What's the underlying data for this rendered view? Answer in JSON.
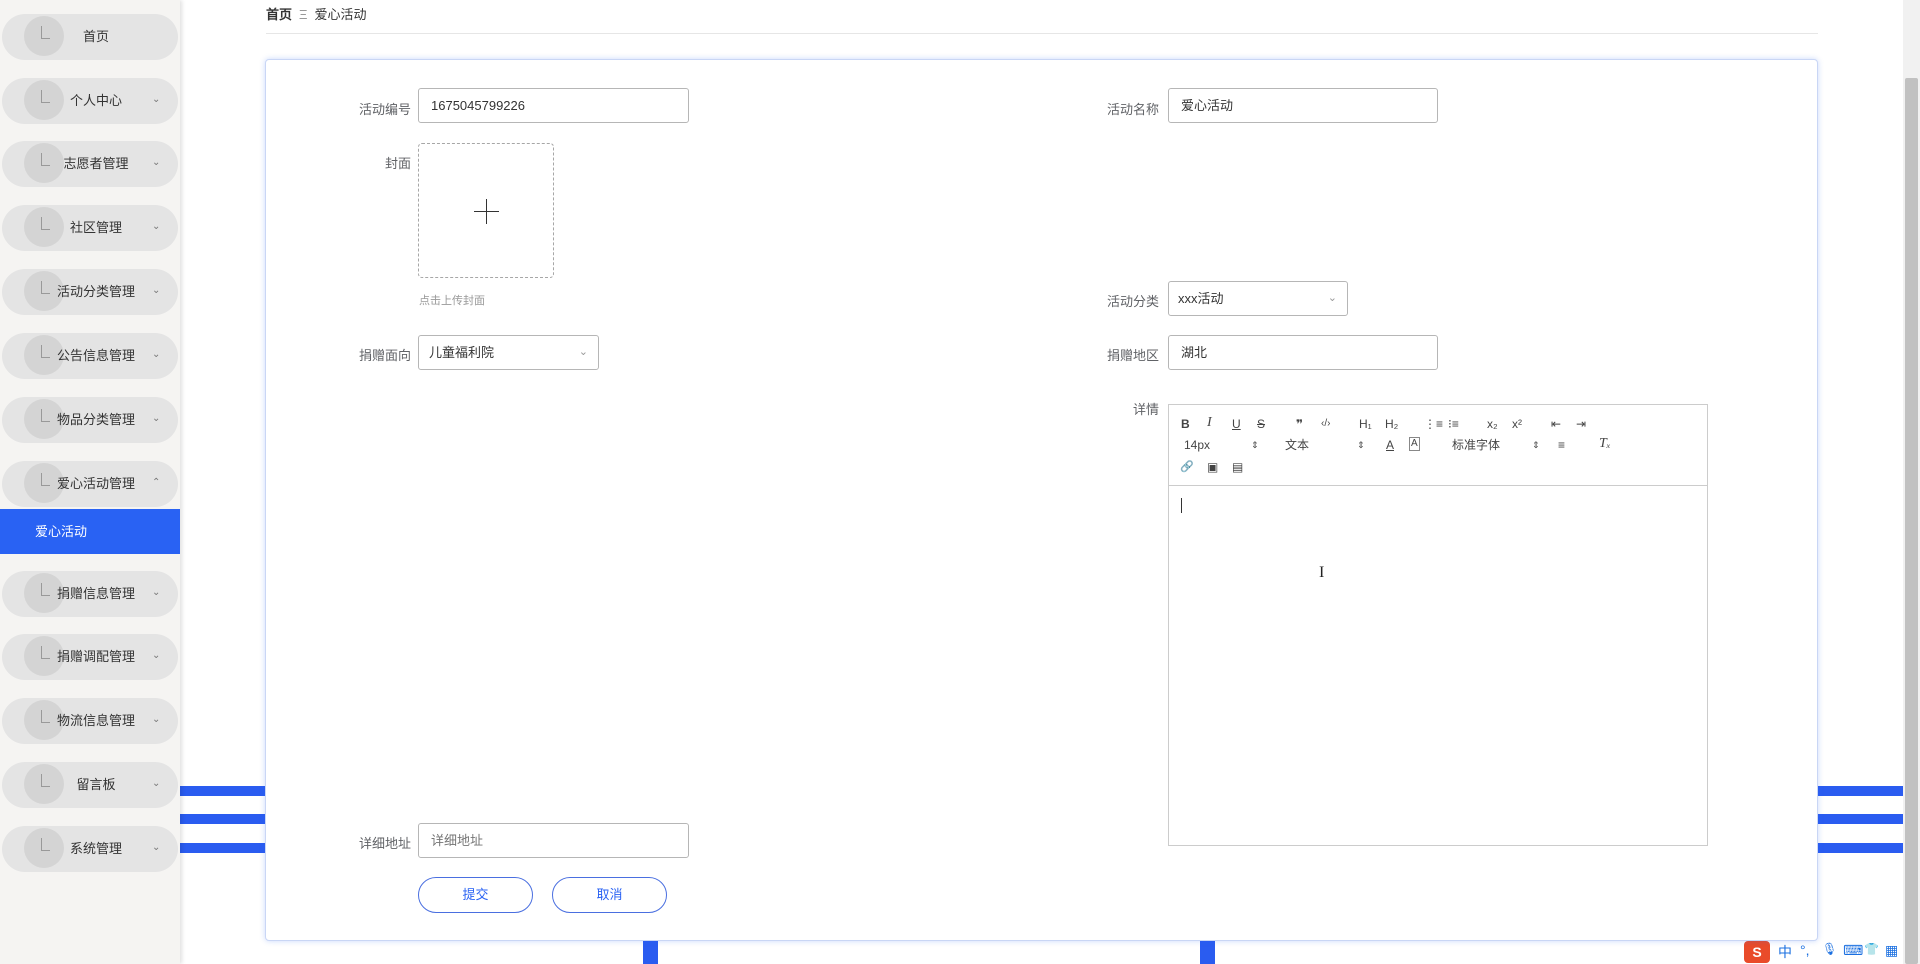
{
  "sidebar": {
    "items": [
      {
        "label": "首页",
        "arrow": ""
      },
      {
        "label": "个人中心",
        "arrow": "⌄"
      },
      {
        "label": "志愿者管理",
        "arrow": "⌄"
      },
      {
        "label": "社区管理",
        "arrow": "⌄"
      },
      {
        "label": "活动分类管理",
        "arrow": "⌄"
      },
      {
        "label": "公告信息管理",
        "arrow": "⌄"
      },
      {
        "label": "物品分类管理",
        "arrow": "⌄"
      },
      {
        "label": "爱心活动管理",
        "arrow": "⌃"
      },
      {
        "label": "捐赠信息管理",
        "arrow": "⌄"
      },
      {
        "label": "捐赠调配管理",
        "arrow": "⌄"
      },
      {
        "label": "物流信息管理",
        "arrow": "⌄"
      },
      {
        "label": "留言板",
        "arrow": "⌄"
      },
      {
        "label": "系统管理",
        "arrow": "⌄"
      }
    ],
    "active_sub": "爱心活动"
  },
  "breadcrumb": {
    "home": "首页",
    "separator": "Ξ",
    "current": "爱心活动"
  },
  "form": {
    "activity_no_label": "活动编号",
    "activity_no_value": "1675045799226",
    "activity_name_label": "活动名称",
    "activity_name_value": "爱心活动",
    "cover_label": "封面",
    "cover_tip": "点击上传封面",
    "category_label": "活动分类",
    "category_value": "xxx活动",
    "direction_label": "捐赠面向",
    "direction_value": "儿童福利院",
    "region_label": "捐赠地区",
    "region_value": "湖北",
    "detail_label": "详情",
    "address_label": "详细地址",
    "address_placeholder": "详细地址",
    "submit_label": "提交",
    "cancel_label": "取消"
  },
  "editor": {
    "size_value": "14px",
    "header_value": "文本",
    "font_value": "标准字体",
    "buttons": {
      "bold": "B",
      "italic": "I",
      "underline": "U",
      "strike": "S",
      "blockquote": "❞",
      "code": "‹/›",
      "h1": "H₁",
      "h2": "H₂",
      "ordered_list": "⋮≡",
      "bullet_list": "⁝≡",
      "sub": "x₂",
      "sup": "x²",
      "outdent": "⇤",
      "indent": "⇥",
      "color": "A",
      "background": "A",
      "align": "≡",
      "clean": "Tₓ",
      "link": "🔗",
      "image": "▣",
      "video": "▤"
    }
  },
  "tray": {
    "logo": "S",
    "lang": "中",
    "punct": "°,",
    "mic": "🎙",
    "keyboard": "⌨",
    "skin": "👕",
    "grid": "▦"
  }
}
